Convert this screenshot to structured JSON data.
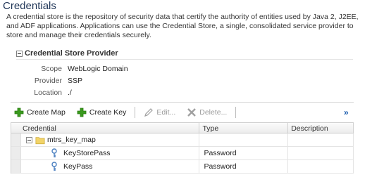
{
  "page": {
    "title": "Credentials",
    "description": "A credential store is the repository of security data that certify the authority of entities used by Java 2, J2EE, and ADF applications. Applications can use the Credential Store, a single, consolidated service provider to store and manage their credentials securely."
  },
  "section": {
    "title": "Credential Store Provider",
    "properties": [
      {
        "label": "Scope",
        "value": "WebLogic Domain"
      },
      {
        "label": "Provider",
        "value": "SSP"
      },
      {
        "label": "Location",
        "value": "./"
      }
    ]
  },
  "toolbar": {
    "create_map": "Create Map",
    "create_key": "Create Key",
    "edit": "Edit...",
    "delete": "Delete...",
    "overflow": "»"
  },
  "table": {
    "headers": {
      "credential": "Credential",
      "type": "Type",
      "description": "Description"
    },
    "rows": [
      {
        "credential": "mtrs_key_map",
        "type": "",
        "description": ""
      },
      {
        "credential": "KeyStorePass",
        "type": "Password",
        "description": ""
      },
      {
        "credential": "KeyPass",
        "type": "Password",
        "description": ""
      }
    ]
  },
  "colors": {
    "title": "#1e3456",
    "add_icon": "#3a9a1e",
    "overflow": "#2060b0",
    "folder": "#f2d46a",
    "key_icon": "#4a7fc0"
  },
  "icons": [
    "collapse-icon",
    "add-icon",
    "pencil-icon",
    "delete-x-icon",
    "folder-icon",
    "key-icon"
  ]
}
